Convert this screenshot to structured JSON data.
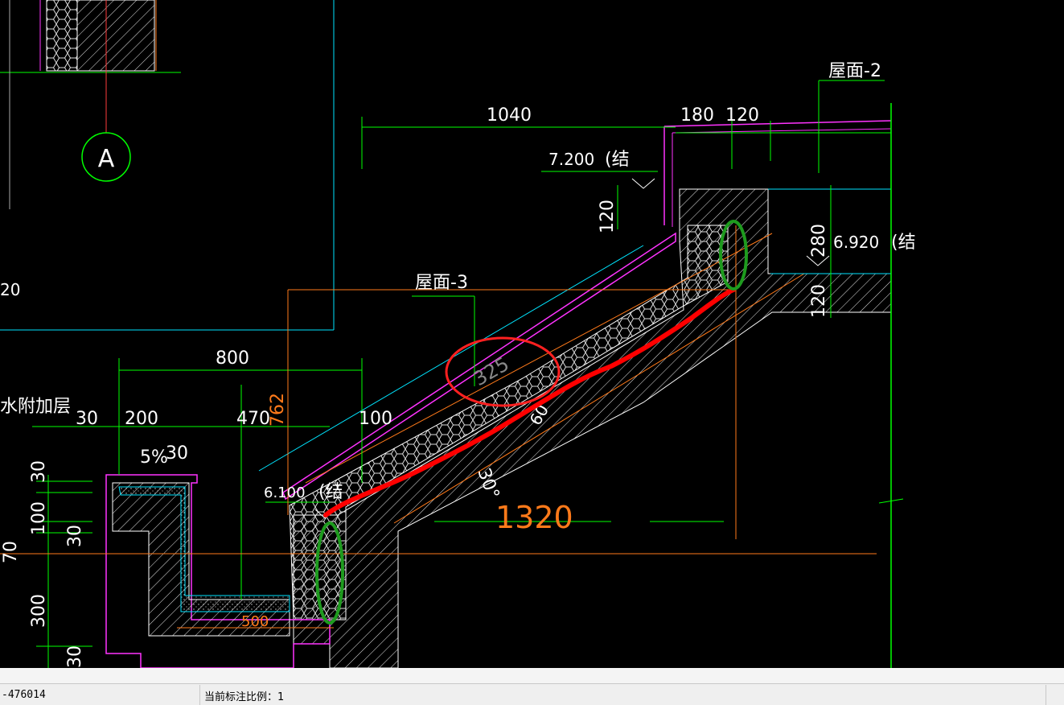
{
  "drawing": {
    "labels": {
      "roof2": "屋面-2",
      "roof3": "屋面-3",
      "axis_a": "A",
      "waterproof": "水附加层",
      "elev_7200": "7.200",
      "elev_6920": "6.920",
      "elev_6100": "6.100",
      "struct_a": "(结",
      "struct_b": "(结",
      "struct_c": "(结",
      "slope": "5%",
      "angle": "30°",
      "left_120": "20"
    },
    "dims": {
      "d1040": "1040",
      "d180": "180",
      "d120a": "120",
      "d120b": "120",
      "d280": "280",
      "d120c": "120",
      "d800": "800",
      "d30": "30",
      "d200": "200",
      "d470": "470",
      "d100": "100",
      "d762": "762",
      "d30b": "30",
      "d1320": "1320",
      "d500": "500",
      "v30": "30",
      "v100": "100",
      "v30b": "30",
      "v300": "300",
      "v30c": "30",
      "v70": "70",
      "d325": "325",
      "d60": "60"
    },
    "colors": {
      "green": "#00ff00",
      "magenta": "#ff33ff",
      "cyan": "#00e5ff",
      "orange": "#ff7a1a",
      "red": "#ff0000",
      "white": "#ffffff",
      "markup_green": "#1e9b1e"
    }
  },
  "status": {
    "coordinate": "-476014",
    "scale_label": "当前标注比例：1"
  }
}
